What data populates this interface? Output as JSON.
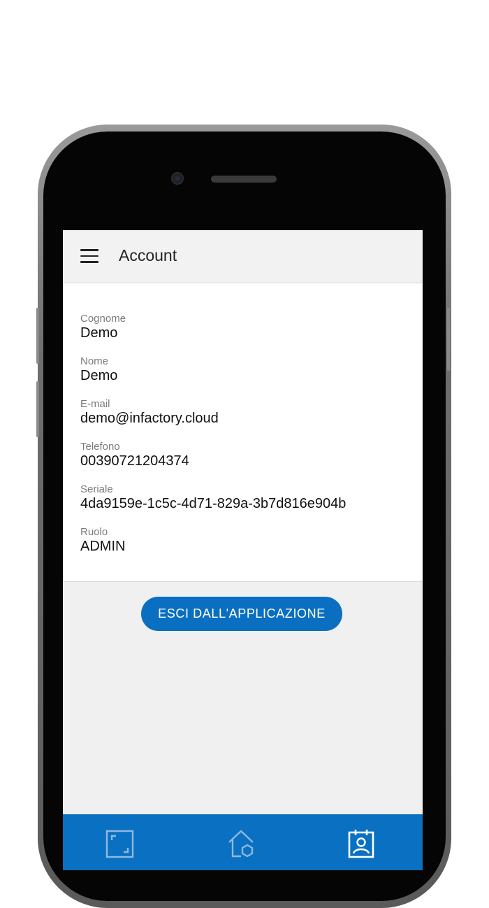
{
  "header": {
    "title": "Account",
    "menu_icon": "hamburger-menu-icon"
  },
  "profile": {
    "fields": [
      {
        "label": "Cognome",
        "value": "Demo"
      },
      {
        "label": "Nome",
        "value": "Demo"
      },
      {
        "label": "E-mail",
        "value": "demo@infactory.cloud"
      },
      {
        "label": "Telefono",
        "value": "00390721204374"
      },
      {
        "label": "Seriale",
        "value": "4da9159e-1c5c-4d71-829a-3b7d816e904b"
      },
      {
        "label": "Ruolo",
        "value": "ADMIN"
      }
    ]
  },
  "actions": {
    "logout_label": "ESCI DALL'APPLICAZIONE"
  },
  "bottom_nav": {
    "items": [
      {
        "icon": "scan-frame-icon",
        "active": false
      },
      {
        "icon": "home-icon",
        "active": false
      },
      {
        "icon": "account-badge-icon",
        "active": true
      }
    ]
  },
  "colors": {
    "accent": "#0a6fc1",
    "nav_background": "#0a70c1",
    "inactive_icon": "#8fb9e2",
    "active_icon": "#ffffff"
  }
}
